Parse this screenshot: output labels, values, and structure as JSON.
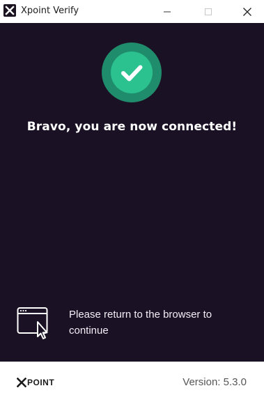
{
  "window": {
    "title": "Xpoint Verify"
  },
  "main": {
    "headline": "Bravo, you are now connected!",
    "hint": "Please return to the browser to continue",
    "status_icon": "check-circle-icon"
  },
  "footer": {
    "logo_text": "POINT",
    "version": "Version: 5.3.0"
  },
  "colors": {
    "background": "#1b1125",
    "success_outer": "#1f8c6b",
    "success_inner": "#2bc28f",
    "text": "#ffffff"
  }
}
